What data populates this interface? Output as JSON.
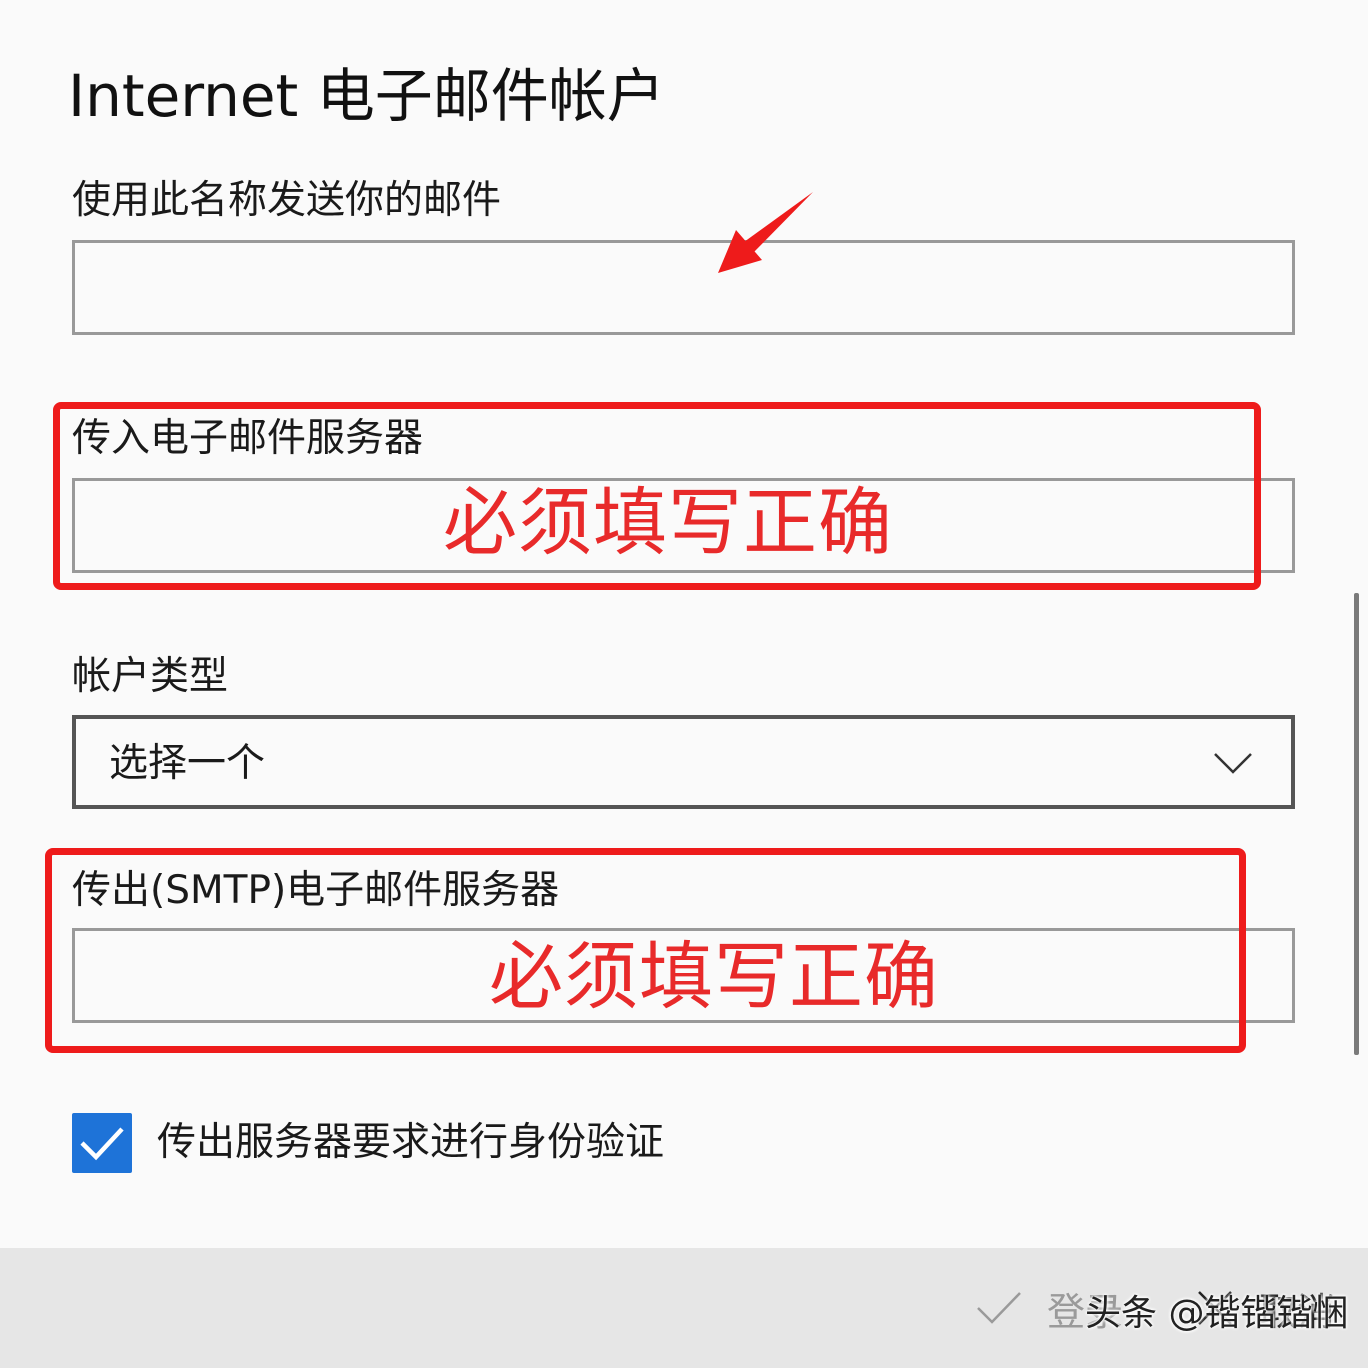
{
  "title": "Internet 电子邮件帐户",
  "fields": {
    "display_name": {
      "label": "使用此名称发送你的邮件",
      "value": ""
    },
    "incoming_server": {
      "label": "传入电子邮件服务器",
      "value": ""
    },
    "account_type": {
      "label": "帐户类型",
      "selected": "选择一个"
    },
    "outgoing_server": {
      "label": "传出(SMTP)电子邮件服务器",
      "value": ""
    }
  },
  "annotations": {
    "incoming_note": "必须填写正确",
    "outgoing_note": "必须填写正确",
    "color": "#ee1b1b"
  },
  "auth_checkbox": {
    "label": "传出服务器要求进行身份验证",
    "checked": true
  },
  "footer": {
    "sign_in_label": "登录",
    "cancel_label": "取消"
  },
  "watermark": "头条 @锴锴锴悃",
  "colors": {
    "accent": "#1e73d8",
    "background": "#fafafa",
    "footer_bg": "#e6e6e6"
  },
  "icons": {
    "chevron": "chevron-down-icon",
    "checkmark": "checkmark-icon",
    "cancel": "close-icon",
    "arrow": "arrow-annotation-icon"
  }
}
